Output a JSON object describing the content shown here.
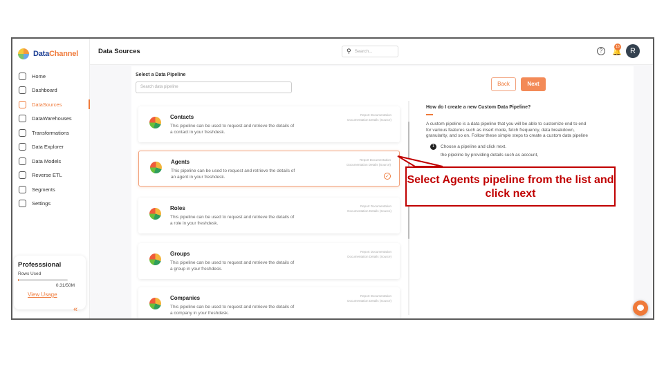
{
  "brand": {
    "name_part1": "Data",
    "name_part2": "Channel"
  },
  "sidebar": {
    "items": [
      {
        "label": "Home",
        "icon": "home-icon"
      },
      {
        "label": "Dashboard",
        "icon": "dashboard-icon"
      },
      {
        "label": "DataSources",
        "icon": "datasources-icon",
        "active": true
      },
      {
        "label": "DataWarehouses",
        "icon": "datawarehouses-icon"
      },
      {
        "label": "Transformations",
        "icon": "transformations-icon"
      },
      {
        "label": "Data Explorer",
        "icon": "data-explorer-icon"
      },
      {
        "label": "Data Models",
        "icon": "data-models-icon"
      },
      {
        "label": "Reverse ETL",
        "icon": "reverse-etl-icon"
      },
      {
        "label": "Segments",
        "icon": "segments-icon"
      },
      {
        "label": "Settings",
        "icon": "settings-icon"
      }
    ],
    "plan": {
      "name": "Professsional",
      "rows_label": "Rows Used",
      "used": "0.31/50M",
      "used_fraction": 0.006,
      "view_usage": "View Usage"
    },
    "collapse_glyph": "«"
  },
  "header": {
    "title": "Data Sources",
    "search_placeholder": "Search...",
    "notification_count": "16",
    "avatar_letter": "R"
  },
  "main": {
    "select_label": "Select a Data Pipeline",
    "search_placeholder": "Search data pipeline",
    "back_label": "Back",
    "next_label": "Next",
    "pipelines": [
      {
        "name": "Contacts",
        "desc": "This pipeline can be used to request and retrieve the details of a contact in your freshdesk.",
        "link1": "Report Documentation",
        "link2": "Documentation Details (Source)"
      },
      {
        "name": "Agents",
        "desc": "This pipeline can be used to request and retrieve the details of an agent in your freshdesk.",
        "link1": "Report Documentation",
        "link2": "Documentation Details (Source)",
        "selected": true
      },
      {
        "name": "Roles",
        "desc": "This pipeline can be used to request and retrieve the details of a role in your freshdesk.",
        "link1": "Report Documentation",
        "link2": "Documentation Details (Source)"
      },
      {
        "name": "Groups",
        "desc": "This pipeline can be used to request and retrieve the details of a group in your freshdesk.",
        "link1": "Report Documentation",
        "link2": "Documentation Details (Source)"
      },
      {
        "name": "Companies",
        "desc": "This pipeline can be used to request and retrieve the details of a company in your freshdesk.",
        "link1": "Report Documentation",
        "link2": "Documentation Details (Source)"
      }
    ],
    "help": {
      "question": "How do I create a new Custom Data Pipeline?",
      "body": "A custom pipeline is a data pipeline that you will be able to customize end to end for various features such as insert mode, fetch frequency, data breakdown, granularity, and so on. Follow these simple steps to create a custom data pipeline",
      "step1_num": "1",
      "step1": "Choose a pipeline and click next.",
      "step2": "the pipeline by providing details such as account,"
    }
  },
  "annotation": {
    "text": "Select Agents pipeline from the list and click next",
    "color": "#c00000"
  },
  "colors": {
    "accent": "#ef7a3a",
    "brand_blue": "#1c3f94"
  }
}
